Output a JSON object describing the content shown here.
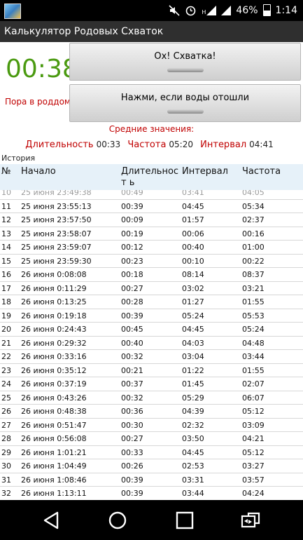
{
  "status_bar": {
    "battery": "46%",
    "time": "1:14",
    "network_letter": "H"
  },
  "app": {
    "title": "Калькулятор Родовых Схваток"
  },
  "timer": {
    "value": "00:38"
  },
  "hint": {
    "text": "Пора в роддом!"
  },
  "buttons": {
    "contraction_label": "Ох! Схватка!",
    "water_label": "Нажми, если воды отошли"
  },
  "averages": {
    "title": "Средние значения:",
    "duration_label": "Длительность",
    "duration_value": "00:33",
    "frequency_label": "Частота",
    "frequency_value": "05:20",
    "interval_label": "Интервал",
    "interval_value": "04:41"
  },
  "history": {
    "label": "История",
    "columns": [
      "№",
      "Начало",
      "Длительност ь",
      "Интервал",
      "Частота"
    ],
    "rows": [
      [
        "10",
        "25 июня 23:49:38",
        "00:49",
        "03:41",
        "04:05"
      ],
      [
        "11",
        "25 июня 23:55:13",
        "00:39",
        "04:45",
        "05:34"
      ],
      [
        "12",
        "25 июня 23:57:50",
        "00:09",
        "01:57",
        "02:37"
      ],
      [
        "13",
        "25 июня 23:58:07",
        "00:19",
        "00:06",
        "00:16"
      ],
      [
        "14",
        "25 июня 23:59:07",
        "00:12",
        "00:40",
        "01:00"
      ],
      [
        "15",
        "25 июня 23:59:30",
        "00:23",
        "00:10",
        "00:22"
      ],
      [
        "16",
        "26 июня 0:08:08",
        "00:18",
        "08:14",
        "08:37"
      ],
      [
        "17",
        "26 июня 0:11:29",
        "00:27",
        "03:02",
        "03:21"
      ],
      [
        "18",
        "26 июня 0:13:25",
        "00:28",
        "01:27",
        "01:55"
      ],
      [
        "19",
        "26 июня 0:19:18",
        "00:39",
        "05:24",
        "05:53"
      ],
      [
        "20",
        "26 июня 0:24:43",
        "00:45",
        "04:45",
        "05:24"
      ],
      [
        "21",
        "26 июня 0:29:32",
        "00:40",
        "04:03",
        "04:48"
      ],
      [
        "22",
        "26 июня 0:33:16",
        "00:32",
        "03:04",
        "03:44"
      ],
      [
        "23",
        "26 июня 0:35:12",
        "00:21",
        "01:22",
        "01:55"
      ],
      [
        "24",
        "26 июня 0:37:19",
        "00:37",
        "01:45",
        "02:07"
      ],
      [
        "25",
        "26 июня 0:43:26",
        "00:32",
        "05:29",
        "06:07"
      ],
      [
        "26",
        "26 июня 0:48:38",
        "00:36",
        "04:39",
        "05:12"
      ],
      [
        "27",
        "26 июня 0:51:47",
        "00:30",
        "02:32",
        "03:09"
      ],
      [
        "28",
        "26 июня 0:56:08",
        "00:27",
        "03:50",
        "04:21"
      ],
      [
        "29",
        "26 июня 1:01:21",
        "00:33",
        "04:45",
        "05:12"
      ],
      [
        "30",
        "26 июня 1:04:49",
        "00:26",
        "02:53",
        "03:27"
      ],
      [
        "31",
        "26 июня 1:08:46",
        "00:39",
        "03:31",
        "03:57"
      ],
      [
        "32",
        "26 июня 1:13:11",
        "00:39",
        "03:44",
        "04:24"
      ]
    ]
  },
  "nav_bar": {
    "back": "back-icon",
    "home": "home-icon",
    "recents": "recents-icon",
    "rotate": "rotate-icon"
  }
}
